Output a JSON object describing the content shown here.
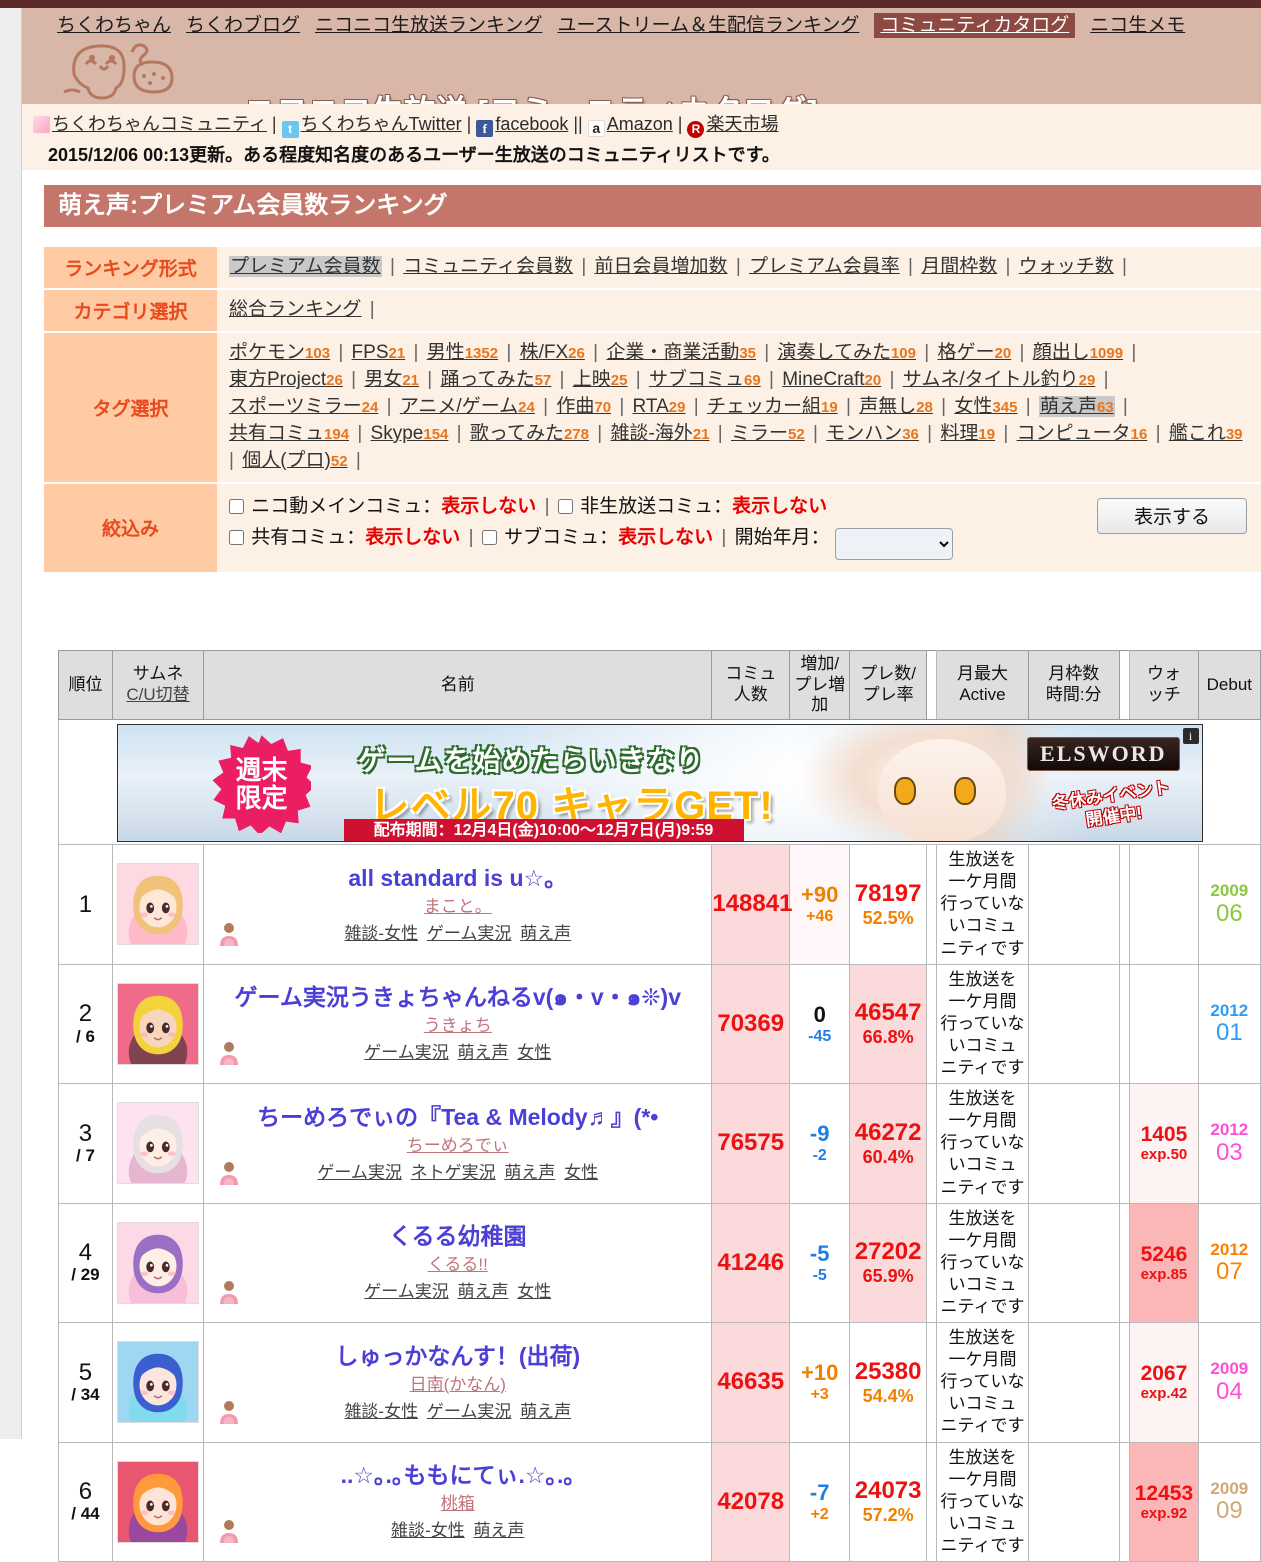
{
  "topnav": {
    "items": [
      {
        "label": "ちくわちゃん",
        "current": false
      },
      {
        "label": "ちくわブログ",
        "current": false
      },
      {
        "label": "ニコニコ生放送ランキング",
        "current": false
      },
      {
        "label": "ユーストリーム＆生配信ランキング",
        "current": false
      },
      {
        "label": "コミュニティカタログ",
        "current": true
      },
      {
        "label": "ニコ生メモ",
        "current": false
      }
    ]
  },
  "brand": {
    "title": "ニコニコ生放送 [コミュニティカタログ]"
  },
  "social": {
    "links": [
      {
        "label": "ちくわちゃんコミュニティ",
        "icon": "rss-icon"
      },
      {
        "label": "ちくわちゃんTwitter",
        "icon": "twitter-icon"
      },
      {
        "label": "facebook",
        "icon": "facebook-icon"
      },
      {
        "label": "Amazon",
        "icon": "amazon-icon"
      },
      {
        "label": "楽天市場",
        "icon": "rakuten-icon"
      }
    ]
  },
  "update_line": "2015/12/06 00:13更新。ある程度知名度のあるユーザー生放送のコミュニティリストです。",
  "page_title": "萌え声:プレミアム会員数ランキング",
  "filters": {
    "ranking_format_label": "ランキング形式",
    "ranking_formats": [
      {
        "label": "プレミアム会員数",
        "selected": true
      },
      {
        "label": "コミュニティ会員数",
        "selected": false
      },
      {
        "label": "前日会員増加数",
        "selected": false
      },
      {
        "label": "プレミアム会員率",
        "selected": false
      },
      {
        "label": "月間枠数",
        "selected": false
      },
      {
        "label": "ウォッチ数",
        "selected": false
      }
    ],
    "category_label": "カテゴリ選択",
    "categories": [
      {
        "label": "総合ランキング",
        "selected": false
      }
    ],
    "tag_label": "タグ選択",
    "tags": [
      {
        "label": "ポケモン",
        "count": "103",
        "selected": false
      },
      {
        "label": "FPS",
        "count": "21",
        "selected": false
      },
      {
        "label": "男性",
        "count": "1352",
        "selected": false
      },
      {
        "label": "株/FX",
        "count": "26",
        "selected": false
      },
      {
        "label": "企業・商業活動",
        "count": "35",
        "selected": false
      },
      {
        "label": "演奏してみた",
        "count": "109",
        "selected": false
      },
      {
        "label": "格ゲー",
        "count": "20",
        "selected": false
      },
      {
        "label": "顔出し",
        "count": "1099",
        "selected": false
      },
      {
        "label": "東方Project",
        "count": "26",
        "selected": false
      },
      {
        "label": "男女",
        "count": "21",
        "selected": false
      },
      {
        "label": "踊ってみた",
        "count": "57",
        "selected": false
      },
      {
        "label": "上映",
        "count": "25",
        "selected": false
      },
      {
        "label": "サブコミュ",
        "count": "69",
        "selected": false
      },
      {
        "label": "MineCraft",
        "count": "20",
        "selected": false
      },
      {
        "label": "サムネ/タイトル釣り",
        "count": "29",
        "selected": false
      },
      {
        "label": "スポーツミラー",
        "count": "24",
        "selected": false
      },
      {
        "label": "アニメ/ゲーム",
        "count": "24",
        "selected": false
      },
      {
        "label": "作曲",
        "count": "70",
        "selected": false
      },
      {
        "label": "RTA",
        "count": "29",
        "selected": false
      },
      {
        "label": "チェッカー組",
        "count": "19",
        "selected": false
      },
      {
        "label": "声無し",
        "count": "28",
        "selected": false
      },
      {
        "label": "女性",
        "count": "345",
        "selected": false
      },
      {
        "label": "萌え声",
        "count": "63",
        "selected": true
      },
      {
        "label": "共有コミュ",
        "count": "194",
        "selected": false
      },
      {
        "label": "Skype",
        "count": "154",
        "selected": false
      },
      {
        "label": "歌ってみた",
        "count": "278",
        "selected": false
      },
      {
        "label": "雑談-海外",
        "count": "21",
        "selected": false
      },
      {
        "label": "ミラー",
        "count": "52",
        "selected": false
      },
      {
        "label": "モンハン",
        "count": "36",
        "selected": false
      },
      {
        "label": "料理",
        "count": "19",
        "selected": false
      },
      {
        "label": "コンピュータ",
        "count": "16",
        "selected": false
      },
      {
        "label": "艦これ",
        "count": "39",
        "selected": false
      },
      {
        "label": "個人(プロ)",
        "count": "52",
        "selected": false
      }
    ],
    "narrow_label": "絞込み",
    "checkboxes": [
      {
        "label": "ニコ動メインコミュ：",
        "value": "表示しない",
        "checked": false
      },
      {
        "label": "非生放送コミュ：",
        "value": "表示しない",
        "checked": false
      },
      {
        "label": "共有コミュ：",
        "value": "表示しない",
        "checked": false
      },
      {
        "label": "サブコミュ：",
        "value": "表示しない",
        "checked": false
      }
    ],
    "start_month_label": "開始年月：",
    "start_month_value": "",
    "submit_label": "表示する"
  },
  "banner": {
    "badge": "週末\n限定",
    "line1": "ゲームを始めたらいきなり",
    "line2": "レベル70 キャラGET!",
    "line3": "配布期間：12月4日(金)10:00～12月7日(月)9:59",
    "logo": "ELSWORD",
    "sub": "冬休みイベント\n開催中!",
    "info_icon": "i"
  },
  "table": {
    "headers": {
      "rank": "順位",
      "thumb_top": "サムネ",
      "thumb_link": "C/U切替",
      "name": "名前",
      "comi": "コミュ\n人数",
      "inc": "増加/\nプレ増加",
      "pre": "プレ数/\nプレ率",
      "active": "月最大\nActive",
      "waku": "月枠数\n時間:分",
      "watch": "ウォ\nッチ",
      "debut": "Debut"
    },
    "rows": [
      {
        "rank": "1",
        "rank_sub": "",
        "name": "all standard is u☆。",
        "owner": "まこと。",
        "tags": [
          "雑談-女性",
          "ゲーム実況",
          "萌え声"
        ],
        "comi": "148841",
        "inc_main": "+90",
        "inc_sub": "+46",
        "inc_main_color": "orange",
        "inc_sub_color": "orange",
        "pre_num": "78197",
        "pre_pct": "52.5%",
        "pre_pct_color": "orange",
        "active": "生放送を一ケ月間行っていないコミュニティです",
        "waku": "",
        "watch": "",
        "watch_exp": "",
        "debut_year": "2009",
        "debut_month": "06",
        "debut_color": "#8dc63f",
        "comi_bg": "bg-pink1",
        "inc_bg": "bg-pinkw",
        "pre_bg": "",
        "watch_bg": ""
      },
      {
        "rank": "2",
        "rank_sub": "/ 6",
        "name": "ゲーム実況うきょちゃんねるv(๑・v・๑❊)v",
        "owner": "うきょち",
        "tags": [
          "ゲーム実況",
          "萌え声",
          "女性"
        ],
        "comi": "70369",
        "inc_main": "0",
        "inc_sub": "-45",
        "inc_main_color": "black",
        "inc_sub_color": "blue",
        "pre_num": "46547",
        "pre_pct": "66.8%",
        "pre_pct_color": "red",
        "active": "生放送を一ケ月間行っていないコミュニティです",
        "waku": "",
        "watch": "",
        "watch_exp": "",
        "debut_year": "2012",
        "debut_month": "01",
        "debut_color": "#2f9bf5",
        "comi_bg": "bg-pink1",
        "inc_bg": "",
        "pre_bg": "bg-pink1",
        "watch_bg": ""
      },
      {
        "rank": "3",
        "rank_sub": "/ 7",
        "name": "ちーめろでぃの『Tea & Melody♬』(*•",
        "owner": "ちーめろでぃ",
        "tags": [
          "ゲーム実況",
          "ネトゲ実況",
          "萌え声",
          "女性"
        ],
        "comi": "76575",
        "inc_main": "-9",
        "inc_sub": "-2",
        "inc_main_color": "blue",
        "inc_sub_color": "blue",
        "pre_num": "46272",
        "pre_pct": "60.4%",
        "pre_pct_color": "red",
        "active": "生放送を一ケ月間行っていないコミュニティです",
        "waku": "",
        "watch": "1405",
        "watch_exp": "exp.50",
        "debut_year": "2012",
        "debut_month": "03",
        "debut_color": "#ff4fd8",
        "comi_bg": "bg-pink1",
        "inc_bg": "",
        "pre_bg": "bg-pink1",
        "watch_bg": "bg-pink3"
      },
      {
        "rank": "4",
        "rank_sub": "/ 29",
        "name": "くるる幼稚園",
        "owner": "くるる!!",
        "tags": [
          "ゲーム実況",
          "萌え声",
          "女性"
        ],
        "comi": "41246",
        "inc_main": "-5",
        "inc_sub": "-5",
        "inc_main_color": "blue",
        "inc_sub_color": "blue",
        "pre_num": "27202",
        "pre_pct": "65.9%",
        "pre_pct_color": "red",
        "active": "生放送を一ケ月間行っていないコミュニティです",
        "waku": "",
        "watch": "5246",
        "watch_exp": "exp.85",
        "debut_year": "2012",
        "debut_month": "07",
        "debut_color": "#ff8000",
        "comi_bg": "bg-pink1",
        "inc_bg": "",
        "pre_bg": "bg-pink1",
        "watch_bg": "bg-red1"
      },
      {
        "rank": "5",
        "rank_sub": "/ 34",
        "name": "しゅっかなんす！(出荷)",
        "owner": "日南(かなん)",
        "tags": [
          "雑談-女性",
          "ゲーム実況",
          "萌え声"
        ],
        "comi": "46635",
        "inc_main": "+10",
        "inc_sub": "+3",
        "inc_main_color": "orange",
        "inc_sub_color": "orange",
        "pre_num": "25380",
        "pre_pct": "54.4%",
        "pre_pct_color": "orange",
        "active": "生放送を一ケ月間行っていないコミュニティです",
        "waku": "",
        "watch": "2067",
        "watch_exp": "exp.42",
        "debut_year": "2009",
        "debut_month": "04",
        "debut_color": "#ff4fd8",
        "comi_bg": "bg-pink1",
        "inc_bg": "",
        "pre_bg": "",
        "watch_bg": "bg-pink3"
      },
      {
        "rank": "6",
        "rank_sub": "/ 44",
        "name": "..☆｡.｡ももにてぃ.☆｡.｡",
        "owner": "桃箱",
        "tags": [
          "雑談-女性",
          "萌え声"
        ],
        "comi": "42078",
        "inc_main": "-7",
        "inc_sub": "+2",
        "inc_main_color": "blue",
        "inc_sub_color": "orange",
        "pre_num": "24073",
        "pre_pct": "57.2%",
        "pre_pct_color": "orange",
        "active": "生放送を一ケ月間行っていないコミュニティです",
        "waku": "",
        "watch": "12453",
        "watch_exp": "exp.92",
        "debut_year": "2009",
        "debut_month": "09",
        "debut_color": "#d2a679",
        "comi_bg": "bg-pink1",
        "inc_bg": "",
        "pre_bg": "",
        "watch_bg": "bg-red1"
      }
    ]
  }
}
